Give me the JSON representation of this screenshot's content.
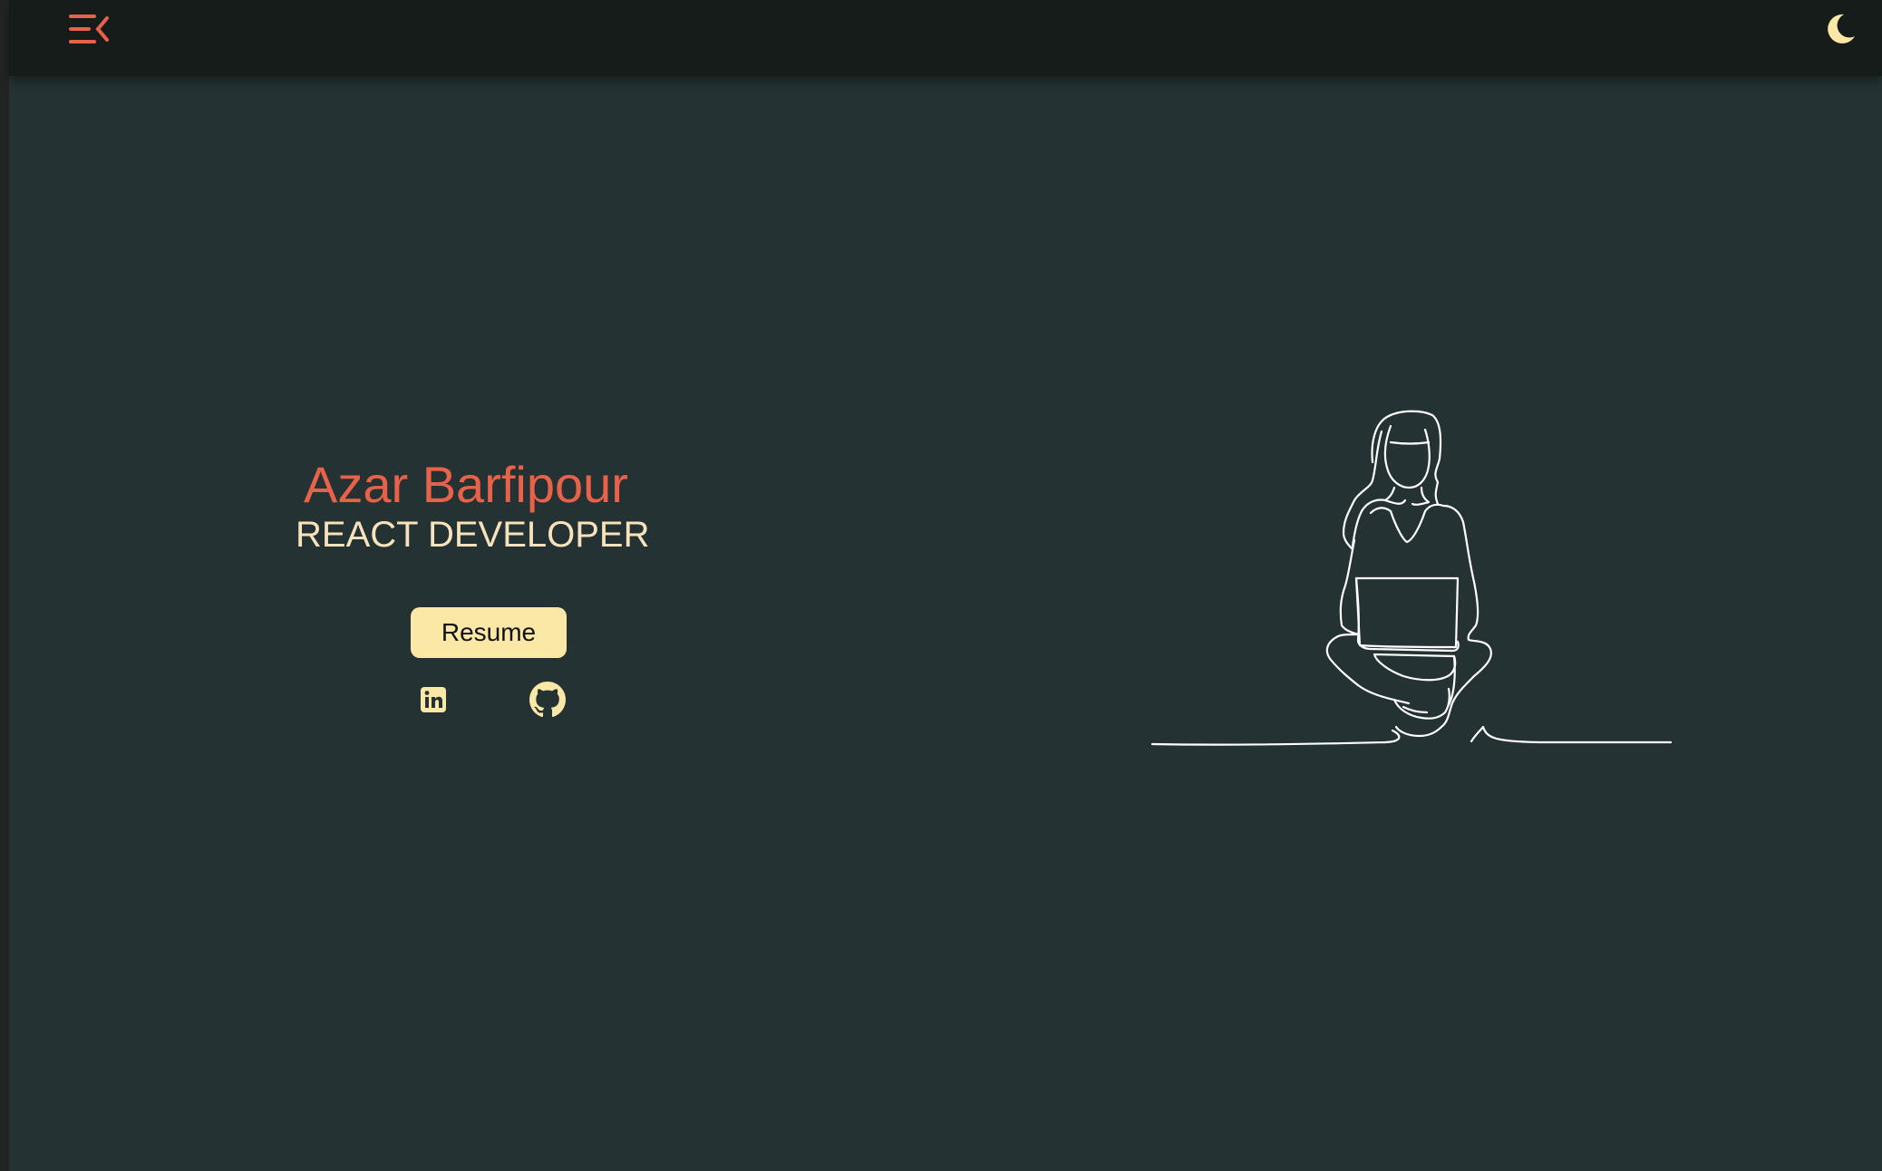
{
  "header": {
    "menu_icon": "menu-collapse-icon",
    "theme_icon": "moon-icon"
  },
  "hero": {
    "name": "Azar Barfipour",
    "role": "REACT DEVELOPER",
    "resume_label": "Resume",
    "social": [
      {
        "icon": "linkedin-icon"
      },
      {
        "icon": "github-icon"
      }
    ],
    "illustration": "woman-with-laptop-line-drawing"
  },
  "colors": {
    "background": "#253233",
    "topbar": "#161c19",
    "accent": "#e8624a",
    "secondary": "#f6e3bd",
    "button": "#fbe8a6"
  }
}
